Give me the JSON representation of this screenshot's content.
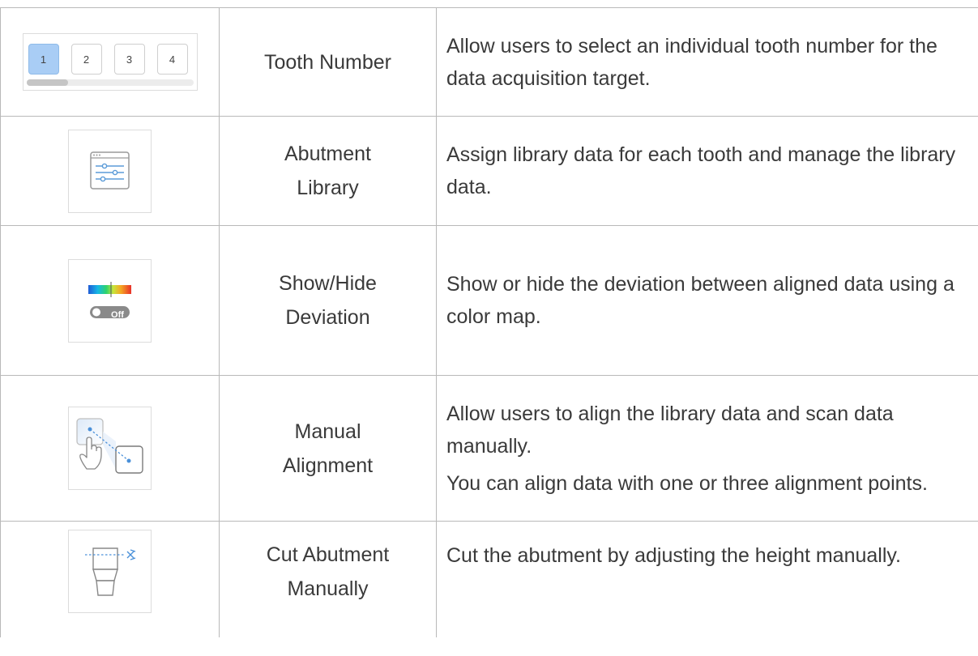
{
  "rows": [
    {
      "icon": "tooth-number-selector-icon",
      "name": [
        "Tooth Number"
      ],
      "desc": [
        "Allow users to select an individual tooth number for the data acquisition target."
      ]
    },
    {
      "icon": "sliders-settings-icon",
      "name": [
        "Abutment",
        "Library"
      ],
      "desc": [
        "Assign library data for each tooth and manage the library data."
      ]
    },
    {
      "icon": "deviation-colormap-toggle-icon",
      "name": [
        "Show/Hide",
        "Deviation"
      ],
      "desc": [
        "Show or hide the deviation between aligned data using a color map."
      ]
    },
    {
      "icon": "manual-alignment-icon",
      "name": [
        "Manual",
        "Alignment"
      ],
      "desc": [
        "Allow users to align the library data and scan data manually.",
        "You can align data with one or three alignment points."
      ]
    },
    {
      "icon": "cut-abutment-icon",
      "name": [
        "Cut Abutment",
        "Manually"
      ],
      "desc": [
        "Cut the abutment by adjusting the height manually."
      ]
    }
  ],
  "tooth_selector": {
    "buttons": [
      "1",
      "2",
      "3",
      "4"
    ],
    "selected": "1",
    "scroll_fraction": 0.25
  },
  "deviation_toggle": {
    "label": "Off"
  },
  "colors": {
    "selected_tooth": "#a9cdf5",
    "accent_blue": "#4a90d9",
    "border": "#b9b9b9"
  }
}
